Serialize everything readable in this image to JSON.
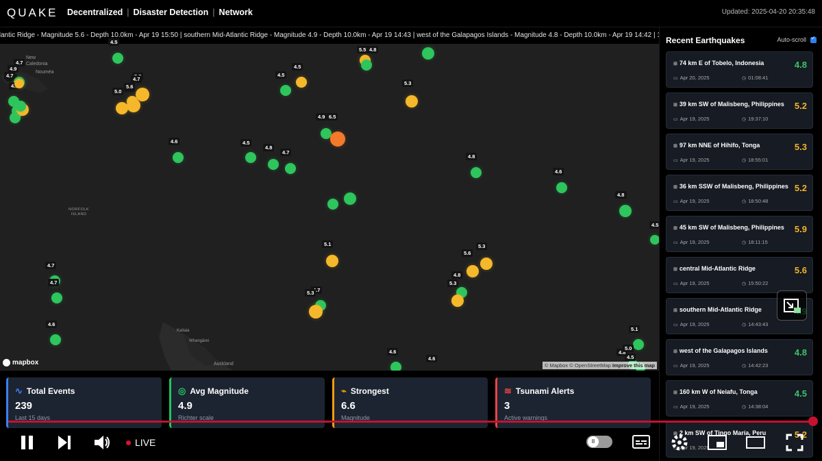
{
  "header": {
    "logo": "QUAKE",
    "nav": [
      "Decentralized",
      "Disaster Detection",
      "Network"
    ],
    "updated": "Updated: 2025-04-20 20:35:48"
  },
  "ticker": "tlantic Ridge - Magnitude 5.6 - Depth 10.0km - Apr 19 15:50 | southern Mid-Atlantic Ridge - Magnitude 4.9 - Depth 10.0km - Apr 19 14:43 | west of the Galapagos Islands - Magnitude 4.8 - Depth 10.0km - Apr 19 14:42 | 160 km W of N",
  "map": {
    "places": {
      "new_caledonia": "New\nCaledonia",
      "noumea": "Nouméa",
      "norfolk": "NORFOLK\nISLAND",
      "kaitaia": "Kaitaia",
      "whangarei": "Whangārei",
      "auckland": "Auckland"
    },
    "mapbox": "mapbox",
    "attribution_text": "© Mapbox © OpenStreetMap",
    "attribution_link": "Improve this map",
    "quakes": [
      {
        "mag": "4.9",
        "color": "green"
      },
      {
        "mag": "4.8",
        "color": "green"
      },
      {
        "mag": "4.7",
        "color": "green"
      },
      {
        "mag": "4.7",
        "color": "green"
      },
      {
        "mag": "4.8",
        "color": "yellow"
      },
      {
        "mag": "4.6",
        "color": "green"
      },
      {
        "mag": "5.8",
        "color": "yellow"
      },
      {
        "mag": "4.7",
        "color": "yellow"
      },
      {
        "mag": "5.0",
        "color": "yellow"
      },
      {
        "mag": "5.6",
        "color": "yellow"
      },
      {
        "mag": "4.5",
        "color": "green"
      },
      {
        "mag": "4.5",
        "color": "green"
      },
      {
        "mag": "4.5",
        "color": "yellow"
      },
      {
        "mag": "5.5",
        "color": "yellow"
      },
      {
        "mag": "4.8",
        "color": "green"
      },
      {
        "mag": "4.9",
        "color": "green"
      },
      {
        "mag": "6.5",
        "color": "orange"
      },
      {
        "mag": "4.6",
        "color": "green"
      },
      {
        "mag": "4.5",
        "color": "green"
      },
      {
        "mag": "4.8",
        "color": "green"
      },
      {
        "mag": "4.7",
        "color": "green"
      },
      {
        "mag": "4.8",
        "color": "green"
      },
      {
        "mag": "4.6",
        "color": "green"
      },
      {
        "mag": "4.5",
        "color": "green"
      },
      {
        "mag": "4.9",
        "color": "green"
      },
      {
        "mag": "4.8",
        "color": "green"
      },
      {
        "mag": "4.5",
        "color": "green"
      },
      {
        "mag": "5.1",
        "color": "yellow"
      },
      {
        "mag": "5.6",
        "color": "yellow"
      },
      {
        "mag": "5.3",
        "color": "yellow"
      },
      {
        "mag": "4.8",
        "color": "green"
      },
      {
        "mag": "5.3",
        "color": "yellow"
      },
      {
        "mag": "4.7",
        "color": "green"
      },
      {
        "mag": "4.7",
        "color": "green"
      },
      {
        "mag": "4.7",
        "color": "green"
      },
      {
        "mag": "5.3",
        "color": "yellow"
      },
      {
        "mag": "4.6",
        "color": "green"
      },
      {
        "mag": "5.3",
        "color": "yellow"
      },
      {
        "mag": "4.6",
        "color": "green"
      },
      {
        "mag": "5.1",
        "color": "green"
      },
      {
        "mag": "4.8",
        "color": "green"
      },
      {
        "mag": "5.0",
        "color": "green"
      },
      {
        "mag": "4.6",
        "color": "green"
      },
      {
        "mag": "4.5",
        "color": "yellow"
      }
    ]
  },
  "sidebar": {
    "title": "Recent Earthquakes",
    "autoscroll_label": "Auto-scroll",
    "items": [
      {
        "location": "74 km E of Tobelo, Indonesia",
        "mag": "4.8",
        "date": "Apr 20, 2025",
        "time": "01:08:41",
        "color": "#3cc46a"
      },
      {
        "location": "39 km SW of Malisbeng, Philippines",
        "mag": "5.2",
        "date": "Apr 19, 2025",
        "time": "19:37:10",
        "color": "#f4b328"
      },
      {
        "location": "97 km NNE of Hihifo, Tonga",
        "mag": "5.3",
        "date": "Apr 19, 2025",
        "time": "18:55:01",
        "color": "#f4b328"
      },
      {
        "location": "36 km SSW of Malisbeng, Philippines",
        "mag": "5.2",
        "date": "Apr 19, 2025",
        "time": "18:50:48",
        "color": "#f4b328"
      },
      {
        "location": "45 km SW of Malisbeng, Philippines",
        "mag": "5.9",
        "date": "Apr 19, 2025",
        "time": "18:11:15",
        "color": "#f4b328"
      },
      {
        "location": "central Mid-Atlantic Ridge",
        "mag": "5.6",
        "date": "Apr 19, 2025",
        "time": "15:50:22",
        "color": "#f4b328"
      },
      {
        "location": "southern Mid-Atlantic Ridge",
        "mag": "4.9",
        "date": "Apr 19, 2025",
        "time": "14:43:43",
        "color": "#3cc46a"
      },
      {
        "location": "west of the Galapagos Islands",
        "mag": "4.8",
        "date": "Apr 19, 2025",
        "time": "14:42:23",
        "color": "#3cc46a"
      },
      {
        "location": "160 km W of Neiafu, Tonga",
        "mag": "4.5",
        "date": "Apr 19, 2025",
        "time": "14:38:04",
        "color": "#3cc46a"
      },
      {
        "location": "2 km SW of Tingo María, Peru",
        "mag": "5.2",
        "date": "Apr 19, 2025",
        "time": "",
        "color": "#f4b328"
      }
    ]
  },
  "stats": [
    {
      "title": "Total Events",
      "value": "239",
      "sub": "Last 15 days",
      "color": "#3b82f6",
      "icon": "activity-icon"
    },
    {
      "title": "Avg Magnitude",
      "value": "4.9",
      "sub": "Richter scale",
      "color": "#22c55e",
      "icon": "globe-icon"
    },
    {
      "title": "Strongest",
      "value": "6.6",
      "sub": "Magnitude",
      "color": "#f59e0b",
      "icon": "pulse-icon"
    },
    {
      "title": "Tsunami Alerts",
      "value": "3",
      "sub": "Active warnings",
      "color": "#ef4444",
      "icon": "waves-icon"
    }
  ],
  "player": {
    "live_label": "LIVE",
    "progress": 1.0
  }
}
